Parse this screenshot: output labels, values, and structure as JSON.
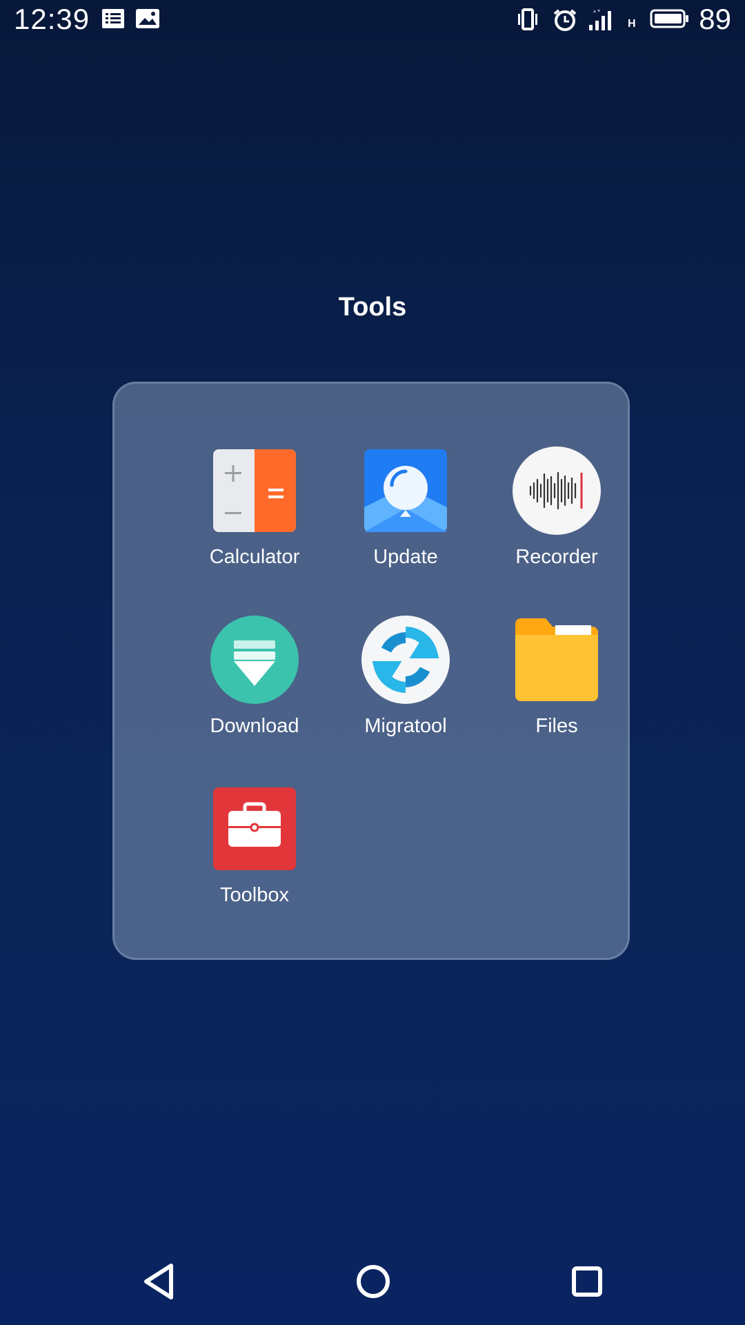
{
  "status_bar": {
    "time": "12:39",
    "battery_percent": "89",
    "network_label": "H",
    "icons": [
      "notes-icon",
      "gallery-icon",
      "vibrate-icon",
      "alarm-icon",
      "signal-icon",
      "battery-icon"
    ]
  },
  "folder": {
    "title": "Tools",
    "apps": [
      {
        "label": "Calculator",
        "icon": "calculator-icon"
      },
      {
        "label": "Update",
        "icon": "update-icon"
      },
      {
        "label": "Recorder",
        "icon": "recorder-icon"
      },
      {
        "label": "Download",
        "icon": "download-icon"
      },
      {
        "label": "Migratool",
        "icon": "migratool-icon"
      },
      {
        "label": "Files",
        "icon": "files-icon"
      },
      {
        "label": "Toolbox",
        "icon": "toolbox-icon"
      }
    ]
  },
  "nav_bar": {
    "buttons": [
      "back-icon",
      "home-icon",
      "recents-icon"
    ]
  },
  "colors": {
    "background_top": "#07183a",
    "background_bottom": "#0a2462",
    "folder_panel": "#6a7b98",
    "calculator_orange": "#ff6a2b",
    "update_blue": "#1f7cf2",
    "download_teal": "#3cc3ad",
    "files_yellow": "#ffc233",
    "toolbox_red": "#e2373a"
  }
}
